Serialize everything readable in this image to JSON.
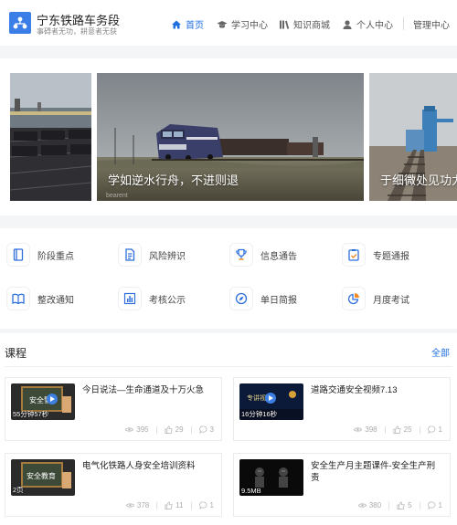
{
  "header": {
    "title": "宁东铁路车务段",
    "subtitle": "事碍者无功，耕意者无获",
    "nav": [
      {
        "label": "首页",
        "icon": "home-icon",
        "active": true
      },
      {
        "label": "学习中心",
        "icon": "graduation-cap-icon"
      },
      {
        "label": "知识商城",
        "icon": "books-icon"
      },
      {
        "label": "个人中心",
        "icon": "user-icon"
      },
      {
        "label": "管理中心",
        "icon": null
      }
    ]
  },
  "banner": {
    "slides": [
      {
        "caption": ""
      },
      {
        "caption": "学如逆水行舟，不进则退"
      },
      {
        "caption": "于细微处见功力"
      }
    ],
    "watermark": "bearent",
    "active_dot": 3,
    "dot_count": 4
  },
  "categories": [
    {
      "label": "阶段重点",
      "icon": "document-outline-icon"
    },
    {
      "label": "风险辨识",
      "icon": "document-lines-icon"
    },
    {
      "label": "信息通告",
      "icon": "trophy-icon"
    },
    {
      "label": "专题通报",
      "icon": "clipboard-check-icon"
    },
    {
      "label": "整改通知",
      "icon": "open-book-icon"
    },
    {
      "label": "考核公示",
      "icon": "bar-chart-icon"
    },
    {
      "label": "单日简报",
      "icon": "compass-icon"
    },
    {
      "label": "月度考试",
      "icon": "pie-chart-icon"
    }
  ],
  "courses": {
    "title": "课程",
    "more": "全部",
    "items": [
      {
        "title": "今日说法—生命通道及十万火急",
        "duration": "55分钟57秒",
        "views": "395",
        "likes": "29",
        "comments": "3",
        "thumb_text": "安全警示"
      },
      {
        "title": "道路交通安全视频7.13",
        "duration": "16分钟16秒",
        "views": "398",
        "likes": "25",
        "comments": "1",
        "thumb_text": "专讲视频"
      },
      {
        "title": "电气化铁路人身安全培训资料",
        "duration": "2页",
        "views": "378",
        "likes": "11",
        "comments": "1",
        "thumb_text": "安全教育"
      },
      {
        "title": "安全生产月主题课件-安全生产刑责",
        "duration": "9.5MB",
        "views": "380",
        "likes": "5",
        "comments": "1",
        "thumb_text": ""
      }
    ]
  },
  "colors": {
    "accent": "#1f6fe0",
    "icon_blue": "#2f6fdc",
    "icon_orange": "#f08a24"
  }
}
